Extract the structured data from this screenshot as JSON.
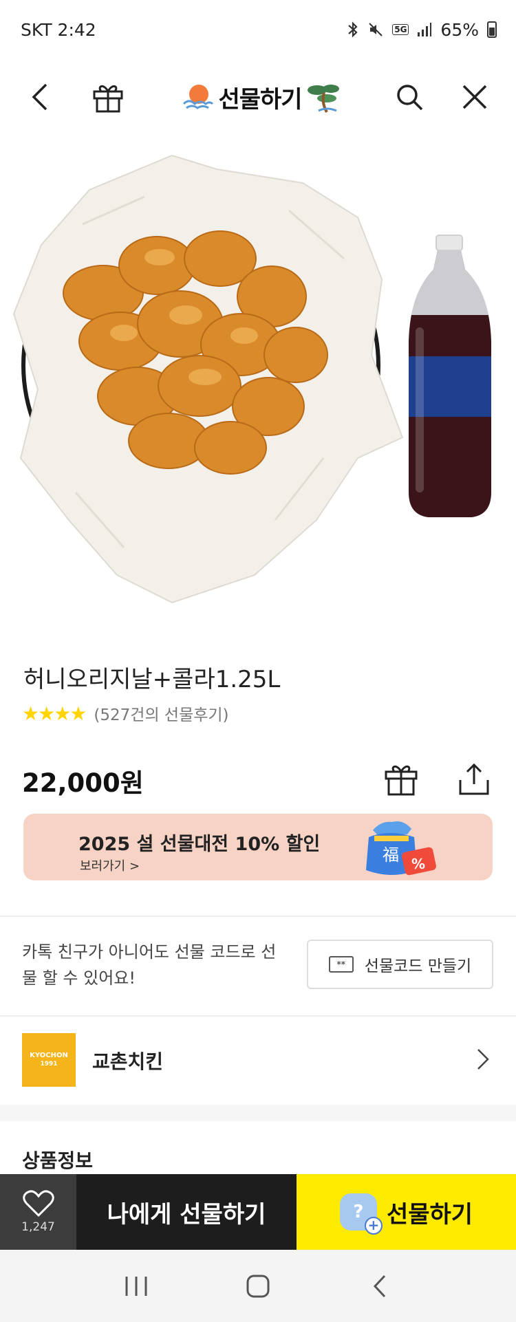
{
  "status_bar": {
    "carrier_time": "SKT 2:42",
    "network": "5G",
    "battery": "65%"
  },
  "nav": {
    "title": "선물하기",
    "icons": [
      "back-icon",
      "gift-box-icon",
      "search-icon",
      "close-icon"
    ]
  },
  "product": {
    "name": "허니오리지날+콜라1.25L",
    "rating_stars": "★★★★",
    "rating": 4,
    "review_text": "(527건의 선물후기)",
    "price": "22,000원"
  },
  "promo": {
    "title": "2025 설 선물대전 10% 할인",
    "link": "보러가기 >",
    "art_char": "福",
    "art_badge": "%",
    "background": "#f6d3c5"
  },
  "gift_code": {
    "description": "카톡 친구가 아니어도 선물 코드로 선물 할 수 있어요!",
    "button_label": "선물코드 만들기",
    "button_icon": "**"
  },
  "brand": {
    "logo_line1": "KYOCHON",
    "logo_line2": "1991",
    "name": "교촌치킨",
    "logo_color": "#f4b41a"
  },
  "section": {
    "title": "상품정보"
  },
  "bottom_bar": {
    "wish_count": "1,247",
    "self_gift_label": "나에게 선물하기",
    "gift_label": "선물하기",
    "gift_icon_char": "?",
    "accent": "#ffeb00"
  },
  "android_nav": {
    "icons": [
      "recent-apps-icon",
      "home-icon",
      "back-icon"
    ]
  }
}
